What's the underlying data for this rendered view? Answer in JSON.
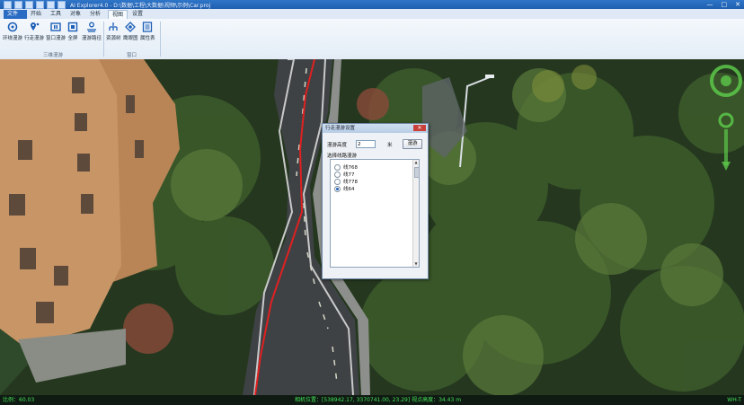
{
  "titlebar": {
    "title": "AI Explorer4.0 - D:\\数据\\工程\\大数据\\视频\\示例\\Car.proj",
    "min": "—",
    "max": "□",
    "close": "✕"
  },
  "tabs": [
    "文件",
    "开始",
    "工具",
    "对象",
    "分析",
    "视图",
    "设置"
  ],
  "active_tab": "视图",
  "ribbon": {
    "buttons": [
      "环绕漫游",
      "行走漫游",
      "窗口漫游",
      "全屏",
      "漫游路径",
      "资源树",
      "鹰眼图",
      "属性表"
    ],
    "groups": [
      "三维漫游",
      "窗口"
    ]
  },
  "dialog": {
    "title": "行走漫游设置",
    "close": "✕",
    "height_label": "漫游高度",
    "height_value": "2",
    "unit": "米",
    "roam_button": "漫游",
    "list_label": "选择线路漫游",
    "options": [
      "线768",
      "线77",
      "线778",
      "线64"
    ],
    "selected_index": 3
  },
  "statusbar": {
    "left": "比例：60.03",
    "center": "相机位置：[538942.17, 3370741.00, 23.29]  视点高度：34.43 m",
    "right": "WH-T"
  },
  "colors": {
    "accent": "#2a6cc3",
    "status_text": "#44e05a",
    "route_line": "#e02020"
  }
}
